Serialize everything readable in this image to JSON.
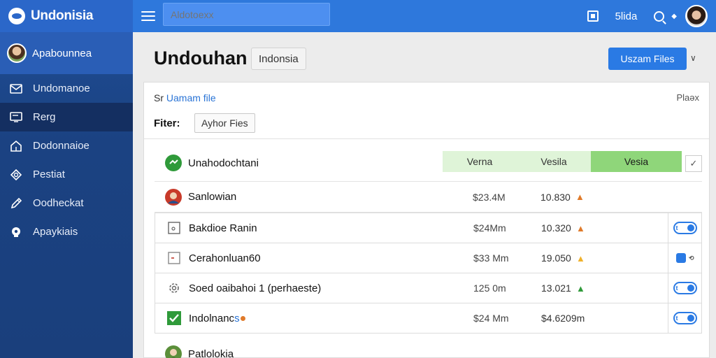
{
  "brand": {
    "name": "Undonisia"
  },
  "sidebar": {
    "user": "Apabounnea",
    "items": [
      {
        "label": "Undomanoe",
        "icon": "mail-icon",
        "active": false
      },
      {
        "label": "Rerg",
        "icon": "screen-icon",
        "active": true
      },
      {
        "label": "Dodonnaioe",
        "icon": "home-icon",
        "active": false
      },
      {
        "label": "Pestiat",
        "icon": "diamond-icon",
        "active": false
      },
      {
        "label": "Oodheckat",
        "icon": "pencil-icon",
        "active": false
      },
      {
        "label": "Apaykiais",
        "icon": "bulb-icon",
        "active": false
      }
    ]
  },
  "topbar": {
    "search_placeholder": "Aldotoexx",
    "user_name": "5lida"
  },
  "header": {
    "title": "Undouhan",
    "tag": "Indonsia",
    "upload_label": "Uszam Files"
  },
  "panel": {
    "link_prefix": "Sr",
    "link_text": "Uamam file",
    "close": "Plaǝx",
    "filter_label": "Fiter:",
    "filter_chip": "Ayhor Fies"
  },
  "table": {
    "header_name": "Unahodochtani",
    "columns": [
      "Verna",
      "Vesila",
      "Vesia"
    ],
    "rows": [
      {
        "name": "Sanlowian",
        "v1": "$23.4M",
        "v2": "10.830",
        "arrow_color": "#e07a2a",
        "icon": "profile-avatar-icon",
        "action": false,
        "boxed": false
      },
      {
        "name": "Bakdioe Ranin",
        "v1": "$24Mm",
        "v2": "10.320",
        "arrow_color": "#e07a2a",
        "icon": "document-icon",
        "action": true,
        "boxed": true
      },
      {
        "name": "Cerahonluan60",
        "v1": "$33 Mm",
        "v2": "19.050",
        "arrow_color": "#f0b12a",
        "icon": "file-icon",
        "action": true,
        "boxed": true
      },
      {
        "name": "Soed oaibahoi 1  (perhaeste)",
        "v1": "125 0m",
        "v2": "13.021",
        "arrow_color": "#2f9a3a",
        "icon": "gear-icon",
        "action": true,
        "boxed": true
      },
      {
        "name": "Indolnanc",
        "name_hl": "s",
        "v1": "$24 Mm",
        "v2": "$4.6209m",
        "arrow_color": "",
        "icon": "leaf-icon",
        "action": true,
        "boxed": true
      },
      {
        "name": "Patlolokia",
        "v1": "",
        "v2": "",
        "arrow_color": "",
        "icon": "profile-avatar-icon",
        "action": false,
        "boxed": false
      }
    ]
  },
  "colors": {
    "topbar": "#2e78dc",
    "sidebar": "#1b4282",
    "accent": "#2a7ae4",
    "green_header": "#8fd67a"
  }
}
